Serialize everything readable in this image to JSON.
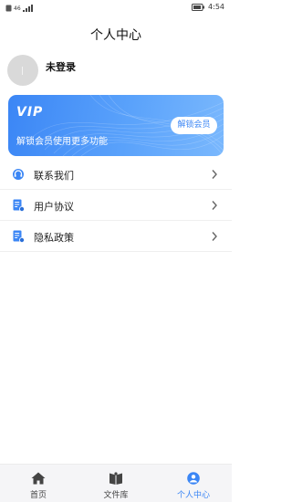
{
  "status_bar": {
    "time": "4:54",
    "signal": "46"
  },
  "header": {
    "title": "个人中心"
  },
  "profile": {
    "name": "未登录"
  },
  "vip": {
    "logo": "VIP",
    "description": "解锁会员使用更多功能",
    "button_label": "解锁会员",
    "accent": "#3b86f5"
  },
  "menu": {
    "items": [
      {
        "label": "联系我们",
        "icon": "headset-icon"
      },
      {
        "label": "用户协议",
        "icon": "document-icon"
      },
      {
        "label": "隐私政策",
        "icon": "document-icon"
      }
    ]
  },
  "tabs": [
    {
      "label": "首页",
      "icon": "home-icon",
      "active": false
    },
    {
      "label": "文件库",
      "icon": "book-icon",
      "active": false
    },
    {
      "label": "个人中心",
      "icon": "person-icon",
      "active": true
    }
  ]
}
